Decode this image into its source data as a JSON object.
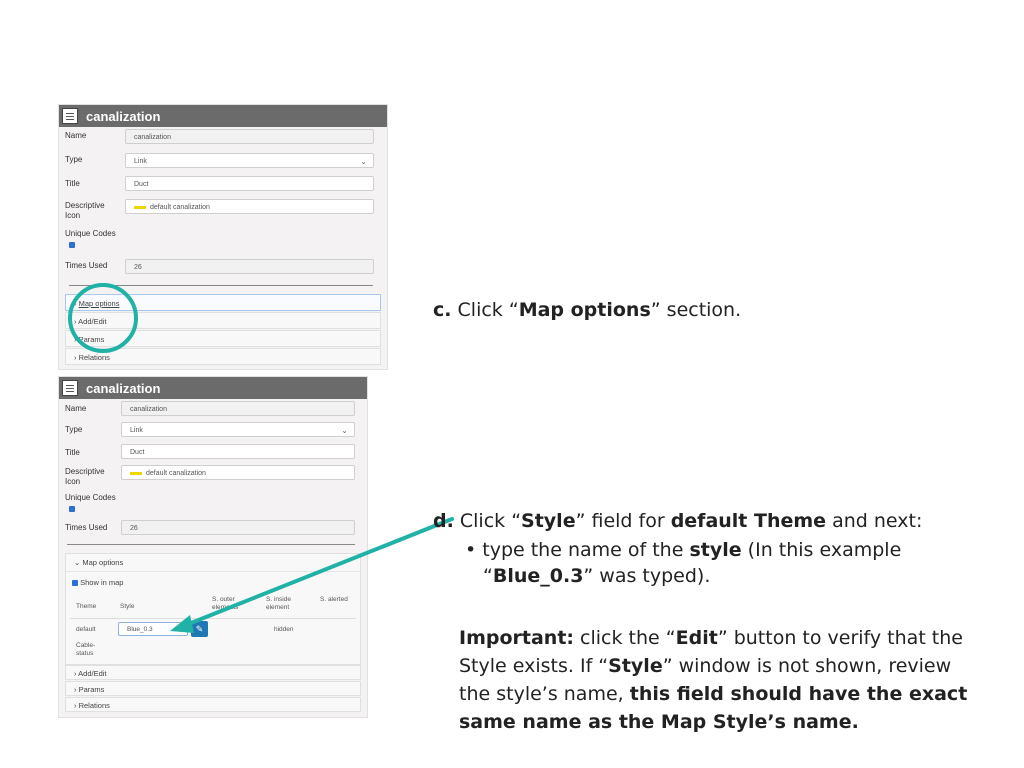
{
  "panel1": {
    "title": "canalization",
    "fields": [
      {
        "label": "Name",
        "value": "canalization"
      },
      {
        "label": "Type",
        "value": "Link"
      },
      {
        "label": "Title",
        "value": "Duct"
      },
      {
        "label": "Descriptive Icon",
        "value": "default canalization"
      },
      {
        "label": "Unique Codes",
        "value": ""
      },
      {
        "label": "Times Used",
        "value": "26"
      }
    ],
    "sections": [
      "Map options",
      "Add/Edit",
      "Params",
      "Relations"
    ]
  },
  "panel2": {
    "title": "canalization",
    "fields": [
      {
        "label": "Name",
        "value": "canalization"
      },
      {
        "label": "Type",
        "value": "Link"
      },
      {
        "label": "Title",
        "value": "Duct"
      },
      {
        "label": "Descriptive Icon",
        "value": "default canalization"
      },
      {
        "label": "Unique Codes",
        "value": ""
      },
      {
        "label": "Times Used",
        "value": "26"
      }
    ],
    "map_options": {
      "section_label": "Map options",
      "show_in_map": "Show in map",
      "columns": [
        "Theme",
        "Style",
        "S. outer elements",
        "S. inside element",
        "S. alerted"
      ],
      "rows": [
        {
          "theme": "default",
          "style": "Blue_0.3",
          "inside": "hidden"
        },
        {
          "theme": "Cable-status",
          "style": "",
          "inside": ""
        }
      ]
    },
    "sections": [
      "Add/Edit",
      "Params",
      "Relations"
    ]
  },
  "instructions": {
    "c_letter": "c.",
    "c_pre": "Click “",
    "c_bold": "Map options",
    "c_post": "” section.",
    "d_letter": "d.",
    "d_pre": "Click “",
    "d_bold1": "Style",
    "d_mid": "” field for ",
    "d_bold2": "default Theme",
    "d_post": " and next:",
    "bullet_pre": "type the name of the ",
    "bullet_bold": "style",
    "bullet_mid": " (In this example",
    "bullet_q_open": "“",
    "bullet_value": "Blue_0.3",
    "bullet_end": "” was typed).",
    "imp_label": "Important:",
    "imp_1": " click the “",
    "imp_edit": "Edit",
    "imp_2": "” button to verify that the",
    "imp_3": "Style exists. If “",
    "imp_style": "Style",
    "imp_4": "” window is not shown, review",
    "imp_5": "the style’s name, ",
    "imp_bold_a": "this field should have the exact",
    "imp_bold_b": "same name as the Map Style’s name."
  },
  "colors": {
    "highlight": "#20b2a6",
    "arrow": "#20b2a6",
    "header": "#6b6b6b"
  }
}
